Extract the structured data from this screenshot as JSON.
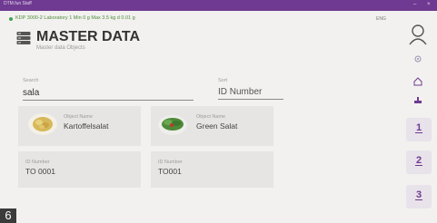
{
  "window": {
    "title": "DTM.fun Staff",
    "controls": [
      "–",
      "×"
    ]
  },
  "status": {
    "text": "KDP 3000-2   Laboratory 1   Min 0 g   Max 3.5 kg   d 0.01 g",
    "language": "ENG"
  },
  "header": {
    "title": "MASTER DATA",
    "subtitle": "Master data Objects"
  },
  "search": {
    "label": "Search",
    "value": "sala"
  },
  "sort": {
    "label": "Sort",
    "value": "ID Number"
  },
  "cards": [
    {
      "object_label": "Object Name",
      "object_name": "Kartoffelsalat",
      "id_label": "ID Number",
      "id_number": "TO 0001"
    },
    {
      "object_label": "Object Name",
      "object_name": "Green Salat",
      "id_label": "ID Number",
      "id_number": "TO001"
    }
  ],
  "sidebar": {
    "tools": [
      "user-icon",
      "settings-icon",
      "home-icon",
      "scale-icon"
    ],
    "numbers": [
      "1",
      "2",
      "3"
    ]
  },
  "footer": {
    "badge": "6"
  },
  "colors": {
    "accent": "#6f3a91",
    "status_green": "#4f8b3b"
  }
}
